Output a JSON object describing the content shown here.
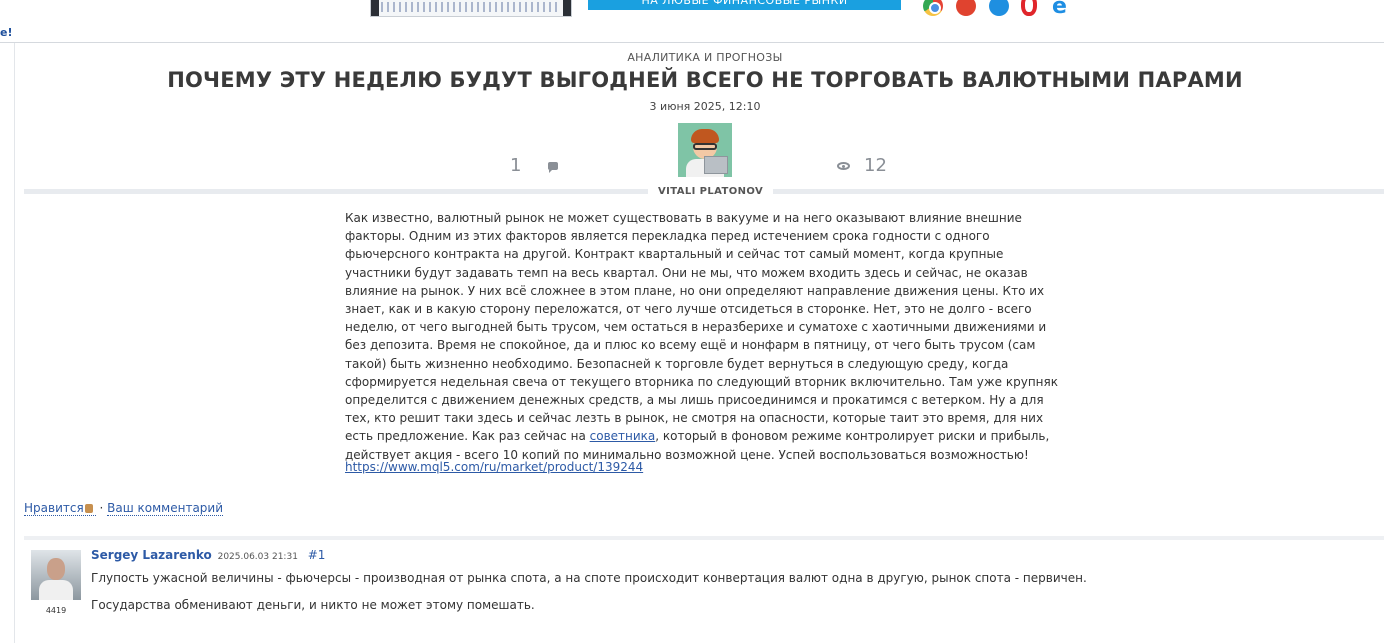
{
  "banner": {
    "cta_text": "НА ЛЮБЫЕ ФИНАНСОВЫЕ РЫНКИ",
    "browser_icons": [
      "chrome-icon",
      "firefox-icon",
      "safari-icon",
      "opera-icon",
      "ie-icon"
    ]
  },
  "left_mark": "e!",
  "article": {
    "category": "АНАЛИТИКА И ПРОГНОЗЫ",
    "title": "ПОЧЕМУ ЭТУ НЕДЕЛЮ БУДУТ ВЫГОДНЕЙ ВСЕГО НЕ ТОРГОВАТЬ ВАЛЮТНЫМИ ПАРАМИ",
    "date": "3 июня 2025, 12:10",
    "comments_count": "1",
    "views_count": "12",
    "author": "VITALI PLATONOV",
    "body_before_link": "Как известно, валютный рынок не может существовать в вакууме и на него оказывают влияние внешние факторы. Одним из этих факторов является перекладка перед истечением срока годности с одного фьючерсного контракта на другой. Контракт квартальный и сейчас тот самый момент, когда крупные участники будут задавать темп на весь квартал. Они не мы, что можем входить здесь и сейчас, не оказав влияние на рынок. У них всё сложнее в этом плане, но они определяют направление движения цены. Кто их знает, как и в какую сторону переложатся, от чего лучше отсидеться в сторонке. Нет, это не долго - всего неделю, от чего выгодней быть трусом, чем остаться в неразберихе и суматохе с хаотичными движениями и без депозита. Время не спокойное, да и плюс ко всему ещё и нонфарм в пятницу, от чего быть трусом (сам такой) быть жизненно необходимо. Безопасней к торговле будет вернуться в следующую среду, когда сформируется недельная свеча от текущего вторника по следующий вторник включительно. Там уже крупняк определится с движением денежных средств, а мы лишь присоединимся и прокатимся с ветерком. Ну а для тех, кто решит таки здесь и сейчас лезть в рынок, не смотря на опасности, которые таит это время, для них есть предложение. Как раз сейчас на ",
    "body_link_text": "советника",
    "body_after_link": ", который в фоновом режиме контролирует риски и прибыль, действует акция - всего 10 копий по минимально возможной цене. Успей воспользоваться возможностью!",
    "product_link": "https://www.mql5.com/ru/market/product/139244"
  },
  "actions": {
    "like": "Нравится",
    "separator": "·",
    "comment": "Ваш комментарий"
  },
  "comment": {
    "author": "Sergey Lazarenko",
    "date": "2025.06.03 21:31",
    "number": "#1",
    "rating": "4419",
    "text1": "Глупость ужасной величины - фьючерсы - производная от рынка спота, а на споте происходит конвертация валют одна в другую, рынок спота - первичен.",
    "text2": "Государства обменивают деньги, и никто не может этому помешать."
  }
}
